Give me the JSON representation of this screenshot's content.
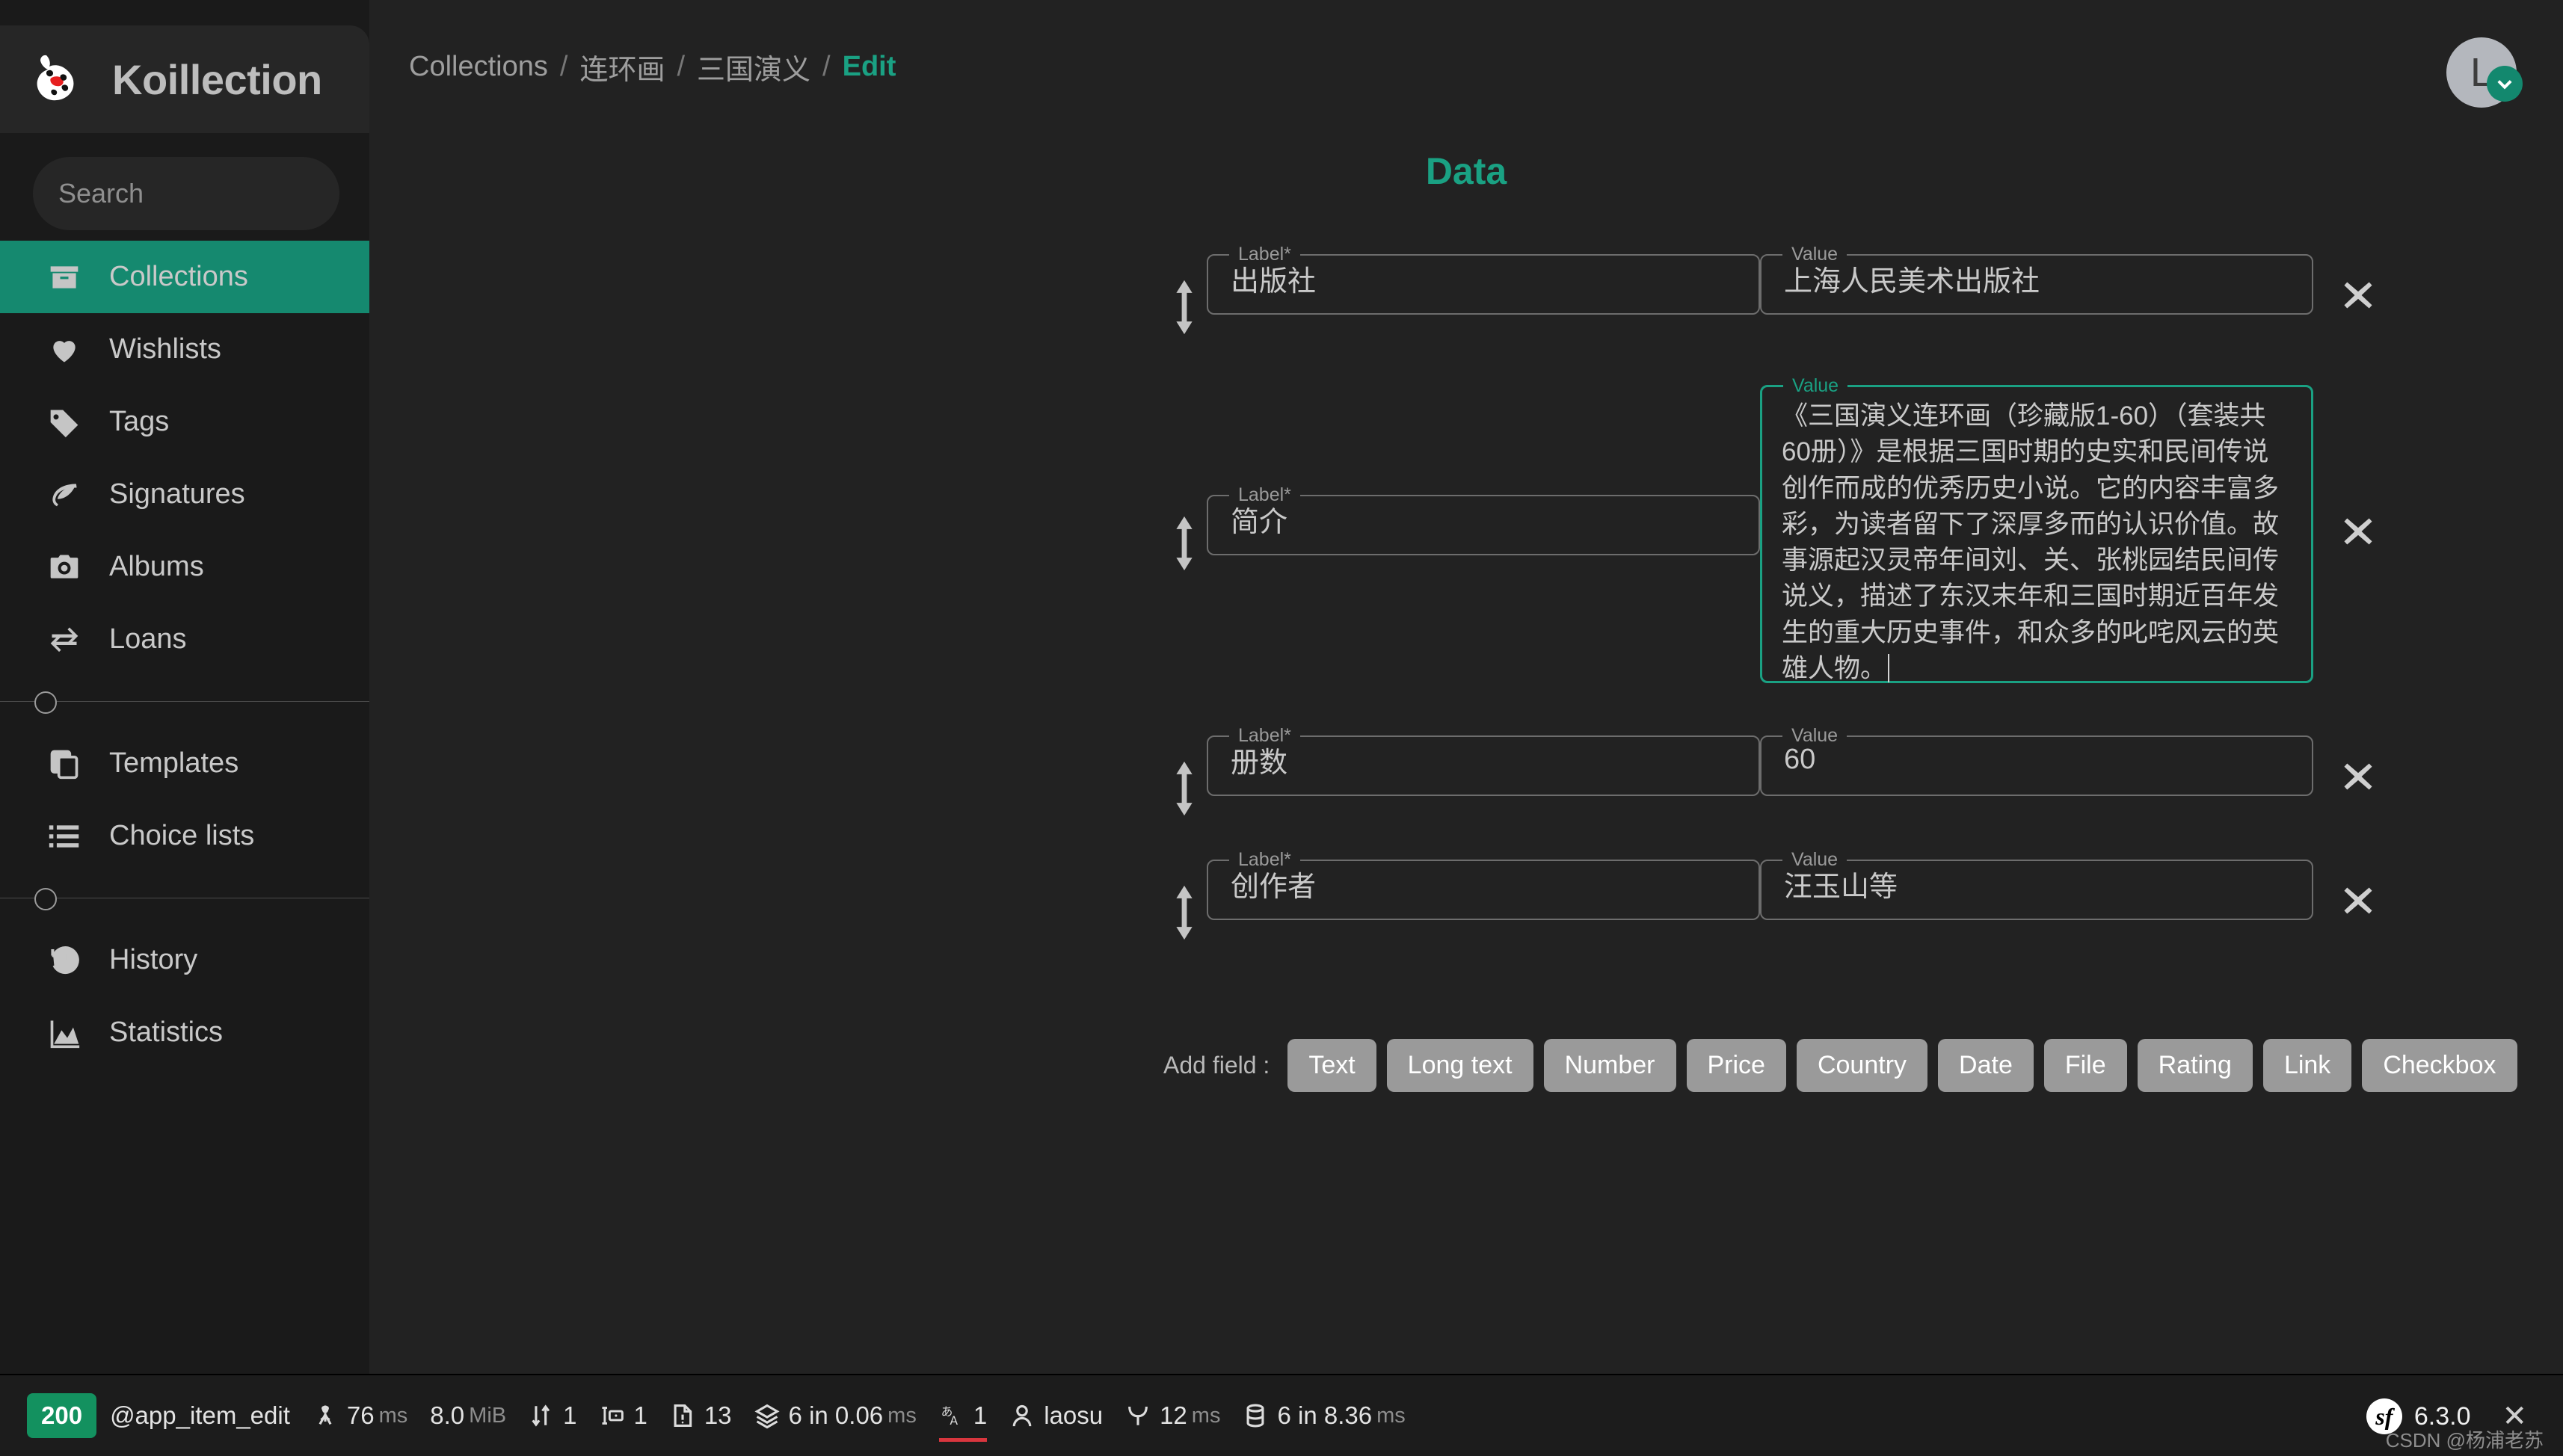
{
  "app": {
    "name": "Koillection",
    "accent": "#15896F",
    "accent_text": "#1AA183",
    "background": "#222222",
    "sidebar_background": "#1a1a1a"
  },
  "search": {
    "placeholder": "Search",
    "value": ""
  },
  "sidebar": {
    "groups": [
      {
        "items": [
          {
            "label": "Collections",
            "icon": "archive-box-icon",
            "active": true
          },
          {
            "label": "Wishlists",
            "icon": "heart-icon",
            "active": false
          },
          {
            "label": "Tags",
            "icon": "tag-icon",
            "active": false
          },
          {
            "label": "Signatures",
            "icon": "leaf-icon",
            "active": false
          },
          {
            "label": "Albums",
            "icon": "camera-icon",
            "active": false
          },
          {
            "label": "Loans",
            "icon": "exchange-arrows-icon",
            "active": false
          }
        ]
      },
      {
        "items": [
          {
            "label": "Templates",
            "icon": "copy-icon",
            "active": false
          },
          {
            "label": "Choice lists",
            "icon": "list-icon",
            "active": false
          }
        ]
      },
      {
        "items": [
          {
            "label": "History",
            "icon": "history-clock-icon",
            "active": false
          },
          {
            "label": "Statistics",
            "icon": "chart-area-icon",
            "active": false
          }
        ]
      }
    ]
  },
  "breadcrumb": {
    "items": [
      "Collections",
      "连环画",
      "三国演义",
      "Edit"
    ],
    "separator": "/",
    "current_index": 3
  },
  "user": {
    "initial": "L",
    "menu_icon": "chevron-down-icon"
  },
  "main": {
    "section_title": "Data",
    "field_label_legend": "Label*",
    "field_value_legend": "Value",
    "rows": [
      {
        "label": "出版社",
        "value": "上海人民美术出版社",
        "type": "text",
        "focused": false
      },
      {
        "label": "简介",
        "value": "《三国演义连环画（珍藏版1-60）（套装共60册）》是根据三国时期的史实和民间传说创作而成的优秀历史小说。它的内容丰富多彩，为读者留下了深厚多而的认识价值。故事源起汉灵帝年间刘、关、张桃园结民间传说义，描述了东汉末年和三国时期近百年发生的重大历史事件，和众多的叱咤风云的英雄人物。",
        "type": "long_text",
        "focused": true
      },
      {
        "label": "册数",
        "value": "60",
        "type": "text",
        "focused": false
      },
      {
        "label": "创作者",
        "value": "汪玉山等",
        "type": "text",
        "focused": false
      }
    ],
    "add_field": {
      "label": "Add field :",
      "buttons": [
        "Text",
        "Long text",
        "Number",
        "Price",
        "Country",
        "Date",
        "File",
        "Rating",
        "Link",
        "Checkbox"
      ]
    }
  },
  "toolbar": {
    "status_code": "200",
    "route": "@app_item_edit",
    "items": [
      {
        "icon": "stopwatch-icon",
        "value": "76",
        "unit": "ms"
      },
      {
        "icon": "memory-icon",
        "value": "8.0",
        "unit": "MiB"
      },
      {
        "icon": "transfer-arrows-icon",
        "value": "1",
        "unit": ""
      },
      {
        "icon": "form-icon",
        "value": "1",
        "unit": ""
      },
      {
        "icon": "log-file-icon",
        "value": "13",
        "unit": ""
      },
      {
        "icon": "layers-icon",
        "value": "6 in 0.06",
        "unit": "ms"
      },
      {
        "icon": "translation-icon",
        "value": "1",
        "unit": "",
        "flagged": true
      },
      {
        "icon": "user-icon",
        "value": "laosu",
        "unit": ""
      },
      {
        "icon": "twig-leaf-icon",
        "value": "12",
        "unit": "ms"
      },
      {
        "icon": "database-icon",
        "value": "6 in 8.36",
        "unit": "ms"
      }
    ],
    "version": "6.3.0",
    "close_icon": "close-icon",
    "logo_text": "sf"
  },
  "watermark": "CSDN @杨浦老苏"
}
